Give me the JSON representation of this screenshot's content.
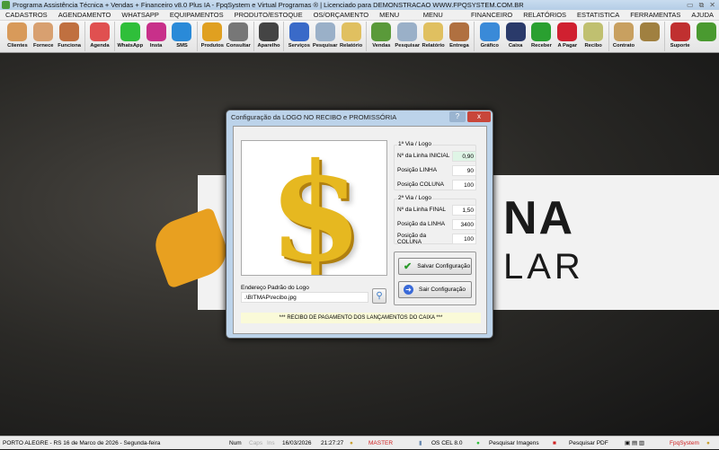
{
  "window": {
    "title": "Programa Assistência Técnica + Vendas + Financeiro v8.0 Plus IA - FpqSystem e Virtual Programas ® | Licenciado para  DEMONSTRACAO WWW.FPQSYSTEM.COM.BR"
  },
  "menu": [
    "CADASTROS",
    "AGENDAMENTO",
    "WHATSAPP",
    "EQUIPAMENTOS",
    "PRODUTO/ESTOQUE",
    "OS/ORÇAMENTO",
    "MENU VENDAS",
    "MENU COMPRAS",
    "FINANCEIRO",
    "RELATÓRIOS",
    "ESTATISTICA",
    "FERRAMENTAS",
    "AJUDA"
  ],
  "toolbar": [
    {
      "label": "Clientes",
      "icon": "users-icon",
      "color": "#d89a5a"
    },
    {
      "label": "Fornece",
      "icon": "supplier-icon",
      "color": "#d8a070"
    },
    {
      "label": "Funciona",
      "icon": "employee-icon",
      "color": "#c07040"
    },
    {
      "sep": true
    },
    {
      "label": "Agenda",
      "icon": "calendar-icon",
      "color": "#e05050"
    },
    {
      "sep": true
    },
    {
      "label": "WhatsApp",
      "icon": "whatsapp-icon",
      "color": "#2fbf3a"
    },
    {
      "label": "Insta",
      "icon": "instagram-icon",
      "color": "#c8308a"
    },
    {
      "label": "SMS",
      "icon": "sms-icon",
      "color": "#2a8ad8"
    },
    {
      "sep": true
    },
    {
      "label": "Produtos",
      "icon": "products-icon",
      "color": "#e0a020"
    },
    {
      "label": "Consultar",
      "icon": "barcode-icon",
      "color": "#777777"
    },
    {
      "sep": true
    },
    {
      "label": "Aparelho",
      "icon": "devices-icon",
      "color": "#444444"
    },
    {
      "sep": true
    },
    {
      "label": "Serviços",
      "icon": "services-icon",
      "color": "#3a6ac8"
    },
    {
      "label": "Pesquisar",
      "icon": "search-docs-icon",
      "color": "#9ab0c8"
    },
    {
      "label": "Relatório",
      "icon": "printer-icon",
      "color": "#e0c060"
    },
    {
      "sep": true
    },
    {
      "label": "Vendas",
      "icon": "cart-icon",
      "color": "#5a9a3a"
    },
    {
      "label": "Pesquisar",
      "icon": "search-docs-icon",
      "color": "#9ab0c8"
    },
    {
      "label": "Relatório",
      "icon": "printer-icon",
      "color": "#e0c060"
    },
    {
      "label": "Entrega",
      "icon": "delivery-icon",
      "color": "#b07040"
    },
    {
      "sep": true
    },
    {
      "label": "Gráfico",
      "icon": "chart-icon",
      "color": "#3a8ad8"
    },
    {
      "label": "Caixa",
      "icon": "cashbook-icon",
      "color": "#2a3a6a"
    },
    {
      "label": "Receber",
      "icon": "receive-money-icon",
      "color": "#2aa030"
    },
    {
      "label": "A Pagar",
      "icon": "pay-money-icon",
      "color": "#d02030"
    },
    {
      "label": "Recibo",
      "icon": "receipt-icon",
      "color": "#c0c070"
    },
    {
      "sep": true
    },
    {
      "label": "Contrato",
      "icon": "contract-icon",
      "color": "#c8a060"
    },
    {
      "label": "",
      "icon": "coin-icon",
      "color": "#a08040"
    },
    {
      "sep": true
    },
    {
      "label": "Suporte",
      "icon": "support-icon",
      "color": "#c03030"
    },
    {
      "label": "",
      "icon": "exit-icon",
      "color": "#4a9a30"
    }
  ],
  "dialog": {
    "title": "Configuração da LOGO NO RECIBO e PROMISSÓRIA",
    "help": "?",
    "close": "x",
    "via1": {
      "title": "1ª Via / Logo",
      "rows": [
        {
          "label": "Nº da Linha INICIAL",
          "value": "0,90"
        },
        {
          "label": "Posição LINHA",
          "value": "90"
        },
        {
          "label": "Posição COLUNA",
          "value": "100"
        }
      ]
    },
    "via2": {
      "title": "2ª Via / Logo",
      "rows": [
        {
          "label": "Nº da Linha FINAL",
          "value": "1,50"
        },
        {
          "label": "Posição da LINHA",
          "value": "3400"
        },
        {
          "label": "Posição da COLUNA",
          "value": "100"
        }
      ]
    },
    "save": "Salvar Configuração",
    "exit": "Sair Configuração",
    "path_label": "Endereço Padrão do Logo",
    "path_value": ".\\BITMAP\\recibo.jpg",
    "footer": "*** RECIBO DE PAGAMENTO DOS LANÇAMENTOS DO CAIXA ***",
    "logo_glyph": "$"
  },
  "background": {
    "line1": "NA",
    "line2": "LAR"
  },
  "status": {
    "location": "PORTO ALEGRE - RS 16 de Marco de 2026 - Segunda-feira",
    "num": "Num",
    "caps": "Caps",
    "ins": "Ins",
    "date": "16/03/2026",
    "time": "21:27:27",
    "user": "MASTER",
    "os": "OS CEL 8.0",
    "search_images": "Pesquisar Imagens",
    "search_pdf": "Pesquisar PDF",
    "brand": "FpqSystem"
  }
}
